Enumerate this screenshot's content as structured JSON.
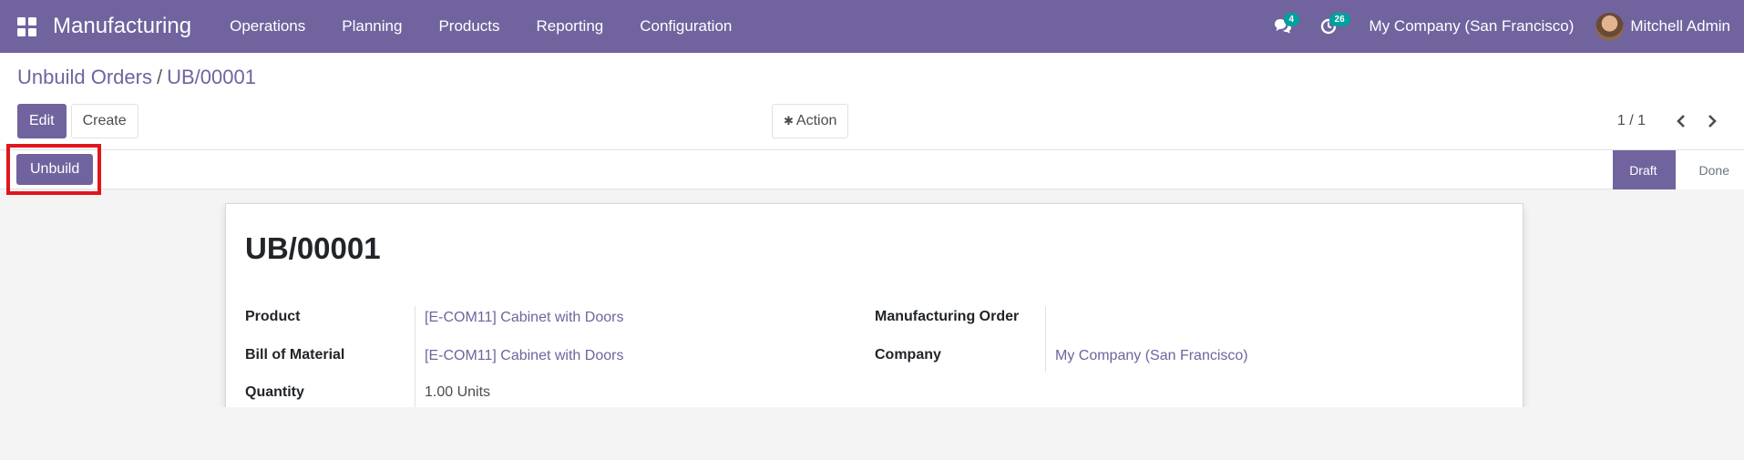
{
  "navbar": {
    "brand": "Manufacturing",
    "menu": [
      "Operations",
      "Planning",
      "Products",
      "Reporting",
      "Configuration"
    ],
    "messages_count": "4",
    "activities_count": "26",
    "company": "My Company (San Francisco)",
    "user": "Mitchell Admin"
  },
  "breadcrumb": {
    "parent": "Unbuild Orders",
    "separator": "/",
    "current": "UB/00001"
  },
  "buttons": {
    "edit": "Edit",
    "create": "Create",
    "action": "Action"
  },
  "pager": {
    "value": "1 / 1"
  },
  "statusbar": {
    "unbuild": "Unbuild",
    "steps": [
      "Draft",
      "Done"
    ],
    "active_step": "Draft"
  },
  "record": {
    "title": "UB/00001",
    "left_fields": [
      {
        "label": "Product",
        "value": "[E-COM11] Cabinet with Doors"
      },
      {
        "label": "Bill of Material",
        "value": "[E-COM11] Cabinet with Doors"
      },
      {
        "label": "Quantity",
        "value": "1.00",
        "unit": "Units"
      }
    ],
    "right_fields": [
      {
        "label": "Manufacturing Order",
        "value": ""
      },
      {
        "label": "Company",
        "value": "My Company (San Francisco)"
      }
    ]
  },
  "colors": {
    "brand": "#71639e",
    "badge": "#00a09d",
    "highlight": "#e0161d"
  }
}
